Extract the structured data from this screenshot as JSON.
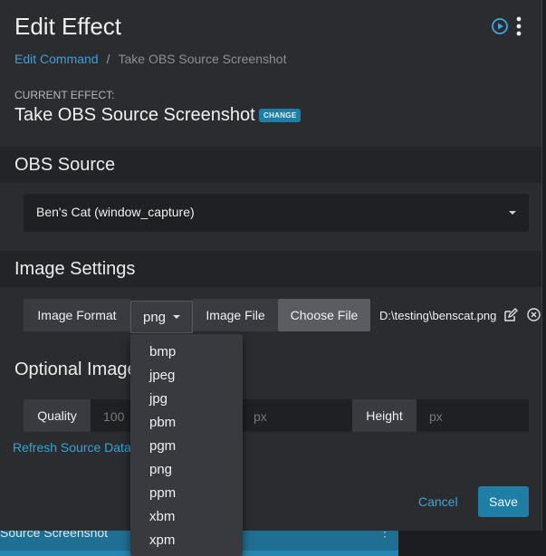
{
  "background": {
    "row_text": "Source Screenshot",
    "row_dots": "⋮"
  },
  "header": {
    "title": "Edit Effect",
    "play_icon": "play-circle-icon",
    "menu_icon": "kebab-menu-icon"
  },
  "breadcrumb": {
    "parent": "Edit Command",
    "separator": "/",
    "current": "Take OBS Source Screenshot"
  },
  "current_effect": {
    "label": "CURRENT EFFECT:",
    "name": "Take OBS Source Screenshot",
    "change_label": "CHANGE"
  },
  "obs_source": {
    "heading": "OBS Source",
    "selected": "Ben's Cat (window_capture)"
  },
  "image_settings": {
    "heading": "Image Settings",
    "format_label": "Image Format",
    "format_value": "png",
    "file_label": "Image File",
    "choose_label": "Choose File",
    "file_path": "D:\\testing\\benscat.png"
  },
  "optional": {
    "heading": "Optional Image Settings",
    "quality_label": "Quality",
    "quality_value": "100",
    "width_placeholder": "px",
    "height_label": "Height",
    "height_placeholder": "px",
    "refresh_link": "Refresh Source Data"
  },
  "footer": {
    "cancel": "Cancel",
    "save": "Save"
  },
  "format_options": [
    "bmp",
    "jpeg",
    "jpg",
    "pbm",
    "pgm",
    "png",
    "ppm",
    "xbm",
    "xpm"
  ],
  "colors": {
    "accent": "#1e7ea6",
    "link": "#3a9fdb",
    "panel": "#2b2c30",
    "section": "#232428"
  }
}
